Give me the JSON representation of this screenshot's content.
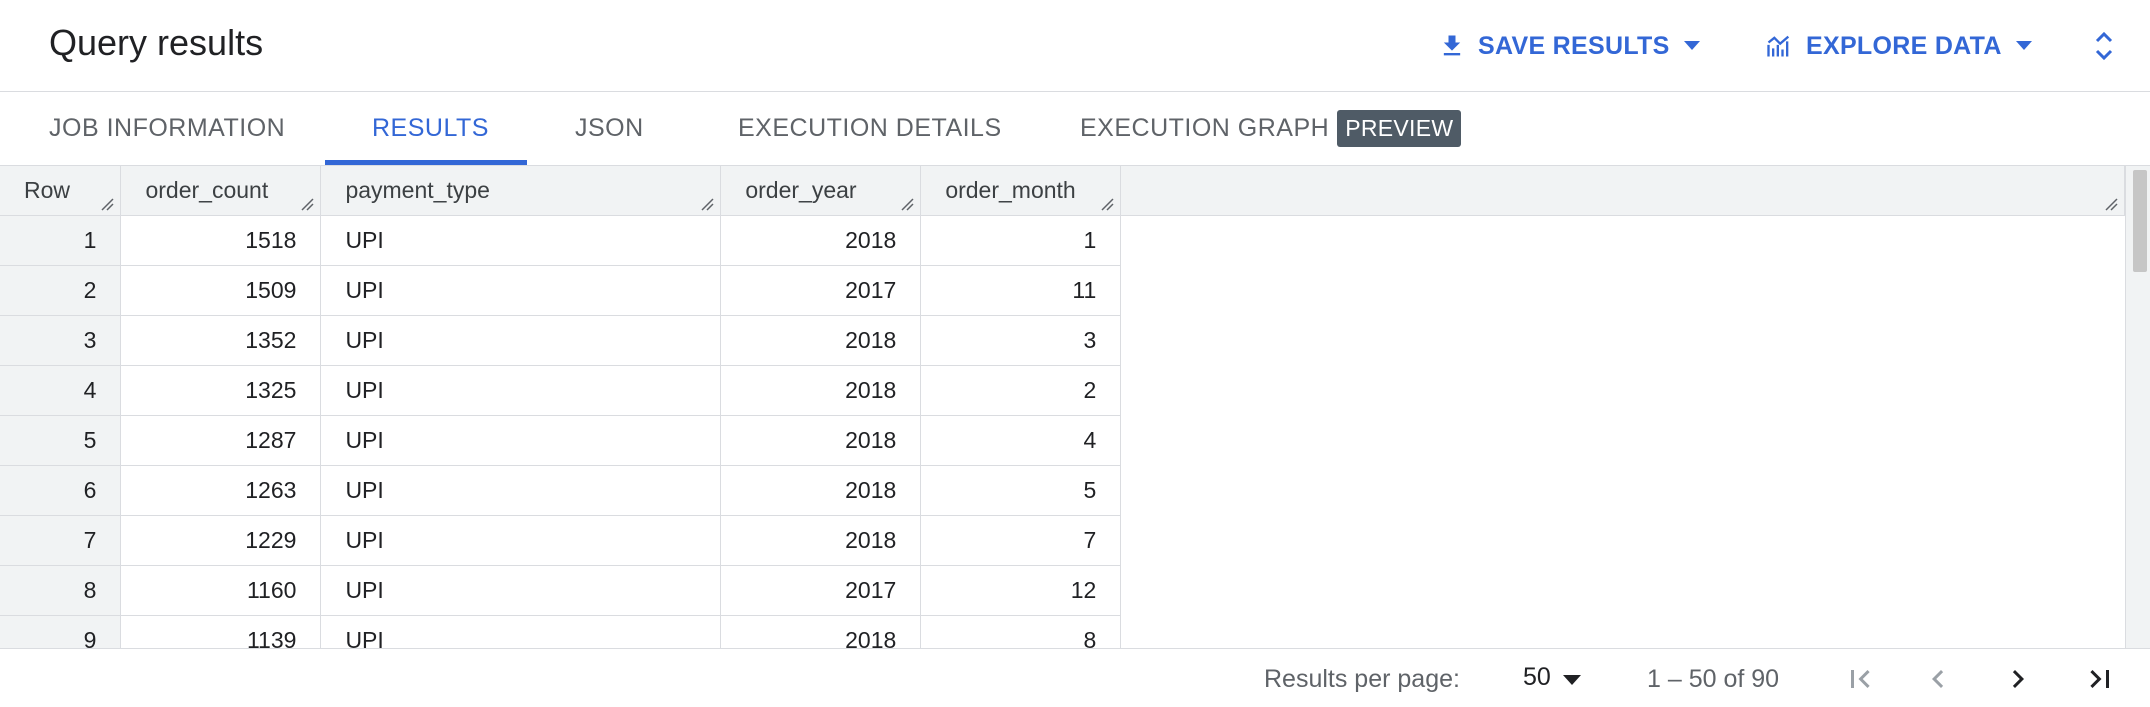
{
  "header": {
    "title": "Query results",
    "save_results_label": "SAVE RESULTS",
    "explore_data_label": "EXPLORE DATA"
  },
  "tabs": [
    {
      "label": "JOB INFORMATION",
      "active": false
    },
    {
      "label": "RESULTS",
      "active": true
    },
    {
      "label": "JSON",
      "active": false
    },
    {
      "label": "EXECUTION DETAILS",
      "active": false
    },
    {
      "label": "EXECUTION GRAPH",
      "active": false,
      "badge": "PREVIEW"
    }
  ],
  "table": {
    "columns": [
      "Row",
      "order_count",
      "payment_type",
      "order_year",
      "order_month"
    ],
    "rows": [
      [
        "1",
        "1518",
        "UPI",
        "2018",
        "1"
      ],
      [
        "2",
        "1509",
        "UPI",
        "2017",
        "11"
      ],
      [
        "3",
        "1352",
        "UPI",
        "2018",
        "3"
      ],
      [
        "4",
        "1325",
        "UPI",
        "2018",
        "2"
      ],
      [
        "5",
        "1287",
        "UPI",
        "2018",
        "4"
      ],
      [
        "6",
        "1263",
        "UPI",
        "2018",
        "5"
      ],
      [
        "7",
        "1229",
        "UPI",
        "2018",
        "7"
      ],
      [
        "8",
        "1160",
        "UPI",
        "2017",
        "12"
      ],
      [
        "9",
        "1139",
        "UPI",
        "2018",
        "8"
      ]
    ]
  },
  "footer": {
    "results_per_page_label": "Results per page:",
    "results_per_page_value": "50",
    "range_text": "1 – 50 of 90"
  },
  "colors": {
    "accent": "#3367d6",
    "badge_bg": "#4f5b66",
    "header_bg": "#f1f3f4",
    "border": "#dadce0"
  },
  "icons": {
    "save": "download-icon",
    "explore": "chart-icon",
    "expand": "unfold-icon",
    "first": "first-page-icon",
    "prev": "chevron-left-icon",
    "next": "chevron-right-icon",
    "last": "last-page-icon"
  }
}
